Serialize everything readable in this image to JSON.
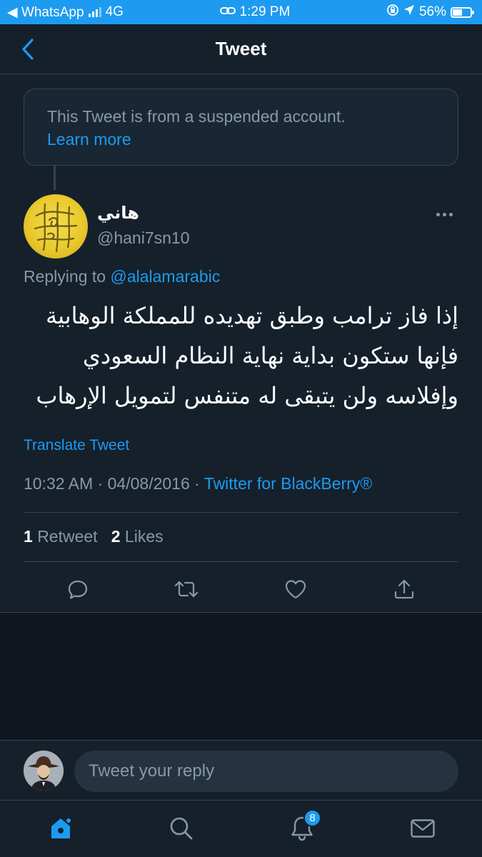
{
  "status_bar": {
    "carrier": "◀ WhatsApp",
    "network": "4G",
    "time": "1:29 PM",
    "battery": "56%",
    "battery_level": 0.56
  },
  "header": {
    "title": "Tweet"
  },
  "notice": {
    "text": "This Tweet is from a suspended account.",
    "link": "Learn more"
  },
  "tweet": {
    "author_name": "هاني",
    "author_handle": "@hani7sn10",
    "replying_label": "Replying to",
    "replying_to": "@alalamarabic",
    "text_lines": [
      "إذا فاز ترامب وطبق تهديده للمملكة الوهابية",
      "فإنها ستكون بداية نهاية النظام السعودي",
      "وإفلاسه ولن يتبقى له متنفس لتمويل الإرهاب"
    ],
    "translate_label": "Translate Tweet",
    "time": "10:32 AM",
    "date": "04/08/2016",
    "source": "Twitter for BlackBerry®",
    "retweet_count": "1",
    "retweet_label": "Retweet",
    "like_count": "2",
    "like_label": "Likes"
  },
  "icons": {
    "reply": "reply-icon",
    "retweet": "retweet-icon",
    "like": "heart-icon",
    "share": "share-icon"
  },
  "reply_bar": {
    "placeholder": "Tweet your reply"
  },
  "tab_bar": {
    "notifications_badge": "8"
  },
  "colors": {
    "background": "#15202b",
    "accent": "#1d9bf0",
    "muted": "#8899a6",
    "border": "#38444d"
  }
}
